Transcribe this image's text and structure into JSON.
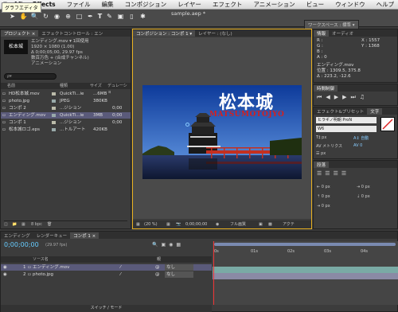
{
  "menubar": {
    "items": [
      "After Effects",
      "ファイル",
      "編集",
      "コンポジション",
      "レイヤー",
      "エフェクト",
      "アニメーション",
      "ビュー",
      "ウィンドウ",
      "ヘルプ"
    ]
  },
  "tooltip": "グラフエディタ",
  "document": {
    "filename": "sample.aep *"
  },
  "workspace": {
    "label": "ワークスペース :",
    "value": "標準"
  },
  "project": {
    "tabs": [
      "プロジェクト ×",
      "エフェクトコントロール : エン"
    ],
    "thumb_text": "松本城",
    "info": [
      "エンディング.mov ▾ 1回使用",
      "1920 × 1080 (1.00)",
      "Δ 0;00;05;00, 29.97 fps",
      "数百万色 + (合成チャンネル)",
      "アニメーション"
    ],
    "search_placeholder": "ρ▾",
    "columns": [
      "名前",
      "種類",
      "サイズ",
      "デュレーショ"
    ],
    "rows": [
      {
        "name": "HD松本城.mov",
        "type": "QuickTi...ie",
        "size": "...6MB",
        "dur": ""
      },
      {
        "name": "photo.jpg",
        "type": "JPEG",
        "size": "380KB",
        "dur": ""
      },
      {
        "name": "コンポ 2",
        "type": "...ジション",
        "size": "",
        "dur": "0;00"
      },
      {
        "name": "エンディング.mov",
        "type": "QuickTi...ie",
        "size": "3MB",
        "dur": "0;00"
      },
      {
        "name": "コンポ 1",
        "type": "...ジション",
        "size": "",
        "dur": "0;00"
      },
      {
        "name": "松本城ロゴ.eps",
        "type": "...トルアート",
        "size": "420KB",
        "dur": ""
      }
    ],
    "bpc": "8 bpc"
  },
  "composition": {
    "tabs": [
      "コンポジション : コンポ 1 ▾",
      "レイヤー : (なし)"
    ],
    "title": "松本城",
    "subtitle": "MATSUMOTOJYO",
    "footer": [
      "(20 %)",
      "0;00;00;00",
      "フル画質",
      "アクテ"
    ]
  },
  "info_panel": {
    "tabs": [
      "情報",
      "オーディオ"
    ],
    "lines": [
      "R :",
      "G :",
      "B :",
      "A : 0"
    ],
    "coords": [
      "X : 1557",
      "Y : 1368"
    ],
    "detail": [
      "エンディング.mov",
      "位置 : 1309.5, 375.8",
      "Δ : 223.2, -12.6"
    ]
  },
  "time_panel": {
    "tab": "時間制御"
  },
  "char_panel": {
    "tabs": [
      "エフェクト&プリセット",
      "文字"
    ],
    "font": "ヒラギノ明朝 ProN",
    "style": "W6",
    "size": "px",
    "auto": "自動",
    "metrics": "メトリクス",
    "val": "0",
    "px_value": "px",
    "pct": "%"
  },
  "para_panel": {
    "tab": "段落",
    "values": [
      "0 px",
      "0 px",
      "0 px",
      "0 px",
      "0 px"
    ]
  },
  "timeline": {
    "tabs": [
      "エンディング",
      "レンダーキュー",
      "コンポ 1 ×"
    ],
    "timecode": "0;00;00;00",
    "fps": "(29.97 fps)",
    "col_source": "ソース名",
    "col_parent": "親",
    "layers": [
      {
        "num": "1",
        "name": "エンディング.mov",
        "parent": "なし"
      },
      {
        "num": "2",
        "name": "photo.jpg",
        "parent": "なし"
      }
    ],
    "ruler": [
      "0s",
      "01s",
      "02s",
      "03s",
      "04s"
    ],
    "bottom_label": "スイッチ / モード"
  },
  "colors": {
    "accent": "#e8b020",
    "sky": "#1d5fbf",
    "bridge": "#c43020",
    "title_red": "#d42020"
  }
}
